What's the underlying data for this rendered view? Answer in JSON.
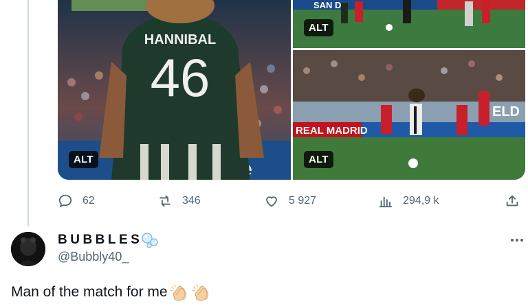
{
  "media": {
    "alt_label": "ALT",
    "left_image": {
      "jersey_name": "HANNIBAL",
      "jersey_number": "46",
      "board_text": "Te"
    },
    "top_right_image": {
      "board_text": "SAN D"
    },
    "bottom_right_image": {
      "board_text_left": "REAL MADRID",
      "board_text_right": "ELD"
    }
  },
  "actions": {
    "replies": "62",
    "reposts": "346",
    "likes": "5 927",
    "views": "294,9 k"
  },
  "reply": {
    "display_name": "BUBBLES",
    "handle": "@Bubbly40_",
    "text": "Man of the match for me"
  },
  "colors": {
    "text_primary": "#0f1419",
    "text_secondary": "#536471",
    "divider": "#cfd9de"
  },
  "icons": [
    "reply-icon",
    "repost-icon",
    "like-icon",
    "views-icon",
    "share-icon",
    "more-icon",
    "bubbles-emoji-icon",
    "clapping-hands-icon"
  ]
}
